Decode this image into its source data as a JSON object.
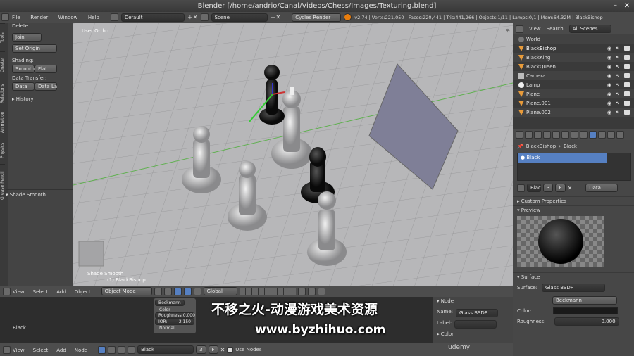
{
  "titlebar": {
    "title": "Blender [/home/andrio/Canal/Videos/Chess/Images/Texturing.blend]"
  },
  "infobar": {
    "menus": [
      "File",
      "Render",
      "Window",
      "Help"
    ],
    "layout": "Default",
    "scene": "Scene",
    "engine": "Cycles Render",
    "stats": "v2.74 | Verts:221,050 | Faces:220,441 | Tris:441,266 | Objects:1/11 | Lamps:0/1 | Mem:64.32M | BlackBishop"
  },
  "toolshelf": {
    "tabs": [
      "Tools",
      "Create",
      "Relations",
      "Animation",
      "Physics",
      "Grease Pencil"
    ],
    "obj_label": "Delete",
    "join": "Join",
    "set_origin": "Set Origin",
    "shading_label": "Shading:",
    "smooth": "Smooth",
    "flat": "Flat",
    "data_transfer_label": "Data Transfer:",
    "data": "Data",
    "data_la": "Data La",
    "history": "History",
    "shade_smooth": "Shade Smooth"
  },
  "viewport": {
    "view_label": "User Ortho",
    "operator": "Shade Smooth",
    "object_label": "(1) BlackBishop"
  },
  "view_header": {
    "menus": [
      "View",
      "Select",
      "Add",
      "Object"
    ],
    "mode": "Object Mode",
    "pivot": "Global"
  },
  "node_editor": {
    "material_name": "Black",
    "beckmann": "Beckmann",
    "color": "Color",
    "roughness_label": "Roughness:",
    "roughness": "0.000",
    "ior_label": "IOR:",
    "ior": "2.150",
    "normal": "Normal"
  },
  "node_panel": {
    "title": "Node",
    "name_label": "Name:",
    "name": "Glass BSDF",
    "label_label": "Label:",
    "color": "Color"
  },
  "node_bar": {
    "menus": [
      "View",
      "Select",
      "Add",
      "Node"
    ],
    "material": "Black",
    "users": "3",
    "fake": "F",
    "use_nodes": "Use Nodes"
  },
  "outliner": {
    "menus": [
      "View",
      "Search"
    ],
    "scenes": "All Scenes",
    "rows": [
      "World",
      "BlackBishop",
      "BlackKing",
      "BlackQueen",
      "Camera",
      "Lamp",
      "Plane",
      "Plane.001",
      "Plane.002"
    ]
  },
  "properties": {
    "breadcrumb_obj": "BlackBishop",
    "breadcrumb_mat": "Black",
    "slot": "Black",
    "mat_short": "Blac",
    "users": "3",
    "fake": "F",
    "data_sel": "Data",
    "custom_props": "Custom Properties",
    "preview": "Preview",
    "surface": "Surface",
    "surface_label": "Surface:",
    "surface_val": "Glass BSDF",
    "distribution": "Beckmann",
    "color_label": "Color:",
    "roughness_label": "Roughness:",
    "roughness": "0.000"
  },
  "watermark": {
    "line1": "不移之火-动漫游戏美术资源",
    "line2": "www.byzhihuo.com",
    "brand": "udemy"
  }
}
